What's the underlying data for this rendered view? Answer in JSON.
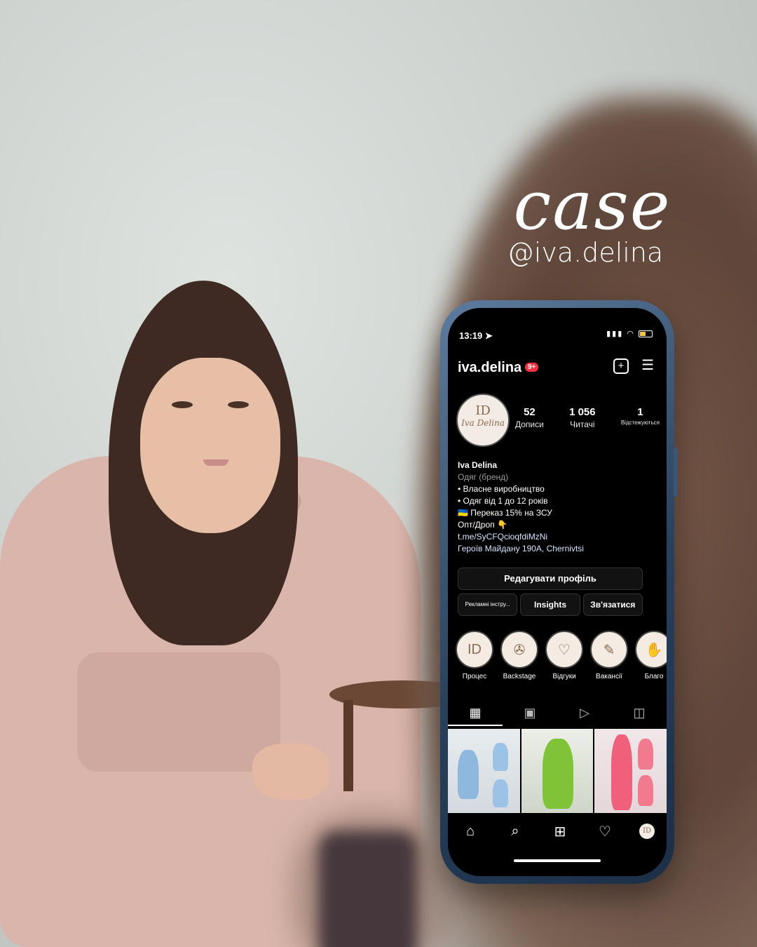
{
  "headline": {
    "title": "case",
    "handle": "@iva.delina"
  },
  "status_bar": {
    "time": "13:19 ➤",
    "icons": "▮▮▮ ◠"
  },
  "profile": {
    "username": "iva.delina",
    "notification_badge": "9+",
    "avatar": {
      "monogram": "ID",
      "brand": "Iva Delina"
    },
    "stats": [
      {
        "value": "52",
        "label": "Дописи"
      },
      {
        "value": "1 056",
        "label": "Читачі"
      },
      {
        "value": "1",
        "label": "Відстежуються"
      }
    ],
    "bio": {
      "name": "Iva Delina",
      "category": "Одяг (бренд)",
      "lines": [
        "• Власне виробництво",
        "• Одяг від 1 до 12 років",
        "🇺🇦 Переказ 15% на ЗСУ",
        "Опт/Дроп 👇"
      ],
      "link": "t.me/SyCFQcioqfdiMzNi",
      "address": "Героїв Майдану 190А, Chernivtsi"
    },
    "buttons": {
      "edit_profile": "Редагувати профіль",
      "ad_tools": "Рекламні інстру...",
      "insights": "Insights",
      "contact": "Зв'язатися"
    },
    "highlights": [
      {
        "label": "Процес",
        "icon": "logo-icon"
      },
      {
        "label": "Backstage",
        "icon": "camera-icon"
      },
      {
        "label": "Відгуки",
        "icon": "speech-heart-icon"
      },
      {
        "label": "Вакансії",
        "icon": "document-pen-icon"
      },
      {
        "label": "Благо",
        "icon": "hand-icon"
      }
    ],
    "tabs": [
      "grid-icon",
      "reels-icon",
      "play-icon",
      "tagged-icon"
    ],
    "bottom_nav": [
      "home-icon",
      "search-icon",
      "create-icon",
      "heart-icon",
      "profile-icon"
    ]
  },
  "colors": {
    "screen_bg": "#000000",
    "badge": "#ff3040",
    "phone_frame": "#2b4668"
  }
}
